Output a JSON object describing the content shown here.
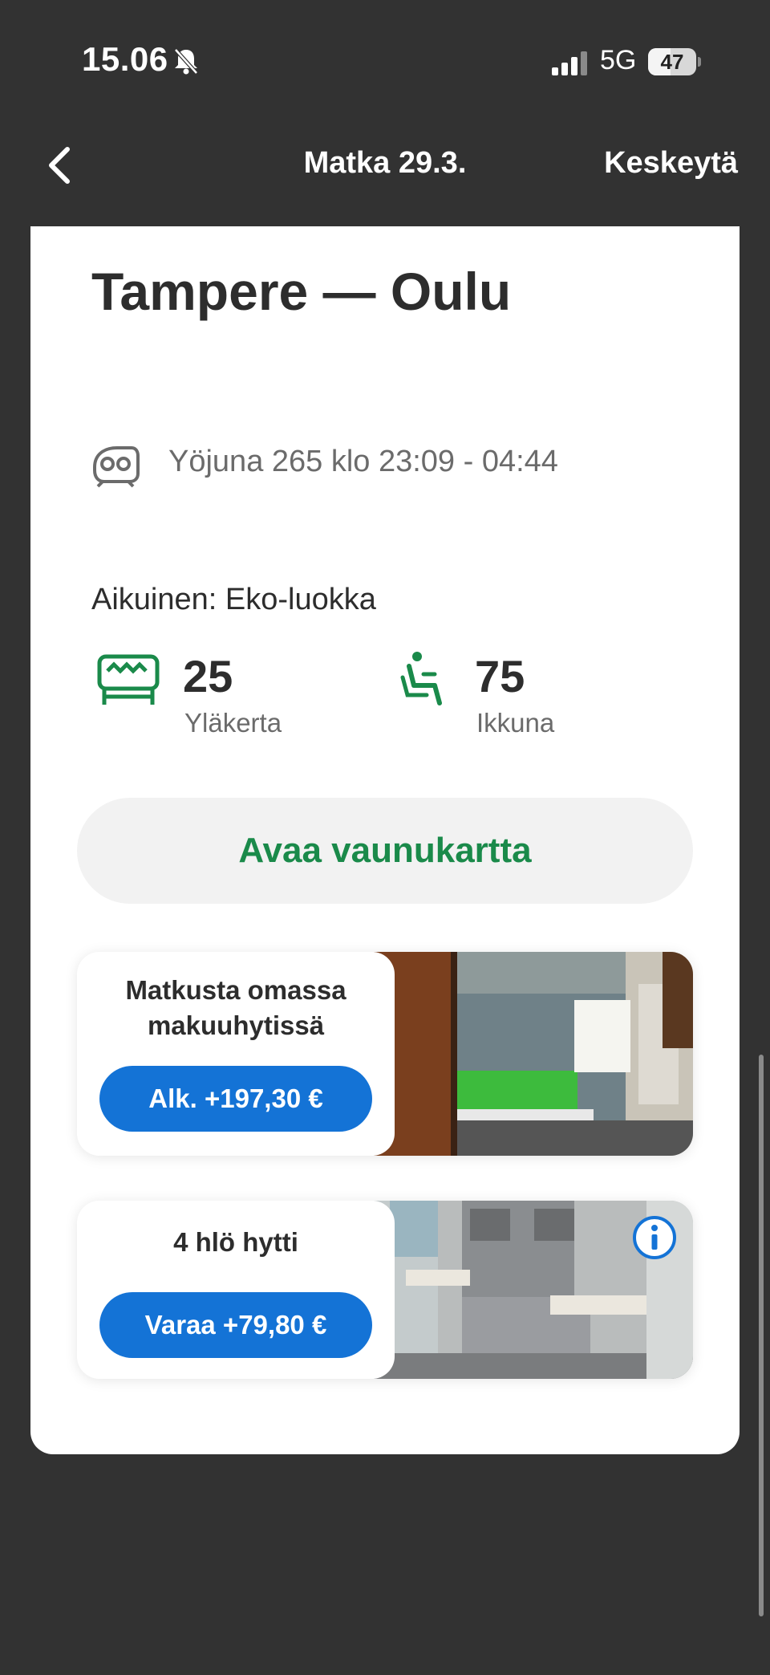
{
  "status_bar": {
    "time": "15.06",
    "network": "5G",
    "battery": "47",
    "battery_level": 0.47,
    "icons": [
      "bell-slash-icon",
      "signal-icon",
      "battery-icon"
    ]
  },
  "nav": {
    "title": "Matka 29.3.",
    "cancel_label": "Keskeytä",
    "back_icon": "chevron-left-icon"
  },
  "journey": {
    "route": "Tampere — Oulu",
    "train_info": "Yöjuna 265 klo 23:09 - 04:44",
    "passenger_class": "Aikuinen: Eko-luokka",
    "seats": [
      {
        "number": "25",
        "label": "Yläkerta",
        "icon": "bed-icon"
      },
      {
        "number": "75",
        "label": "Ikkuna",
        "icon": "seat-icon"
      }
    ],
    "wagon_map_label": "Avaa vaunukartta"
  },
  "offers": [
    {
      "title": "Matkusta omassa makuuhytissä",
      "button": "Alk. +197,30 €",
      "photo": "sleeper-cabin-photo"
    },
    {
      "title": "4 hlö hytti",
      "button": "Varaa +79,80 €",
      "photo": "seat-cabin-photo",
      "info_icon": "info-icon"
    }
  ],
  "colors": {
    "background": "#323232",
    "accent_green": "#1a8a4a",
    "accent_blue": "#1473d6",
    "text_dark": "#2d2d2d",
    "text_muted": "#6b6b6b"
  }
}
